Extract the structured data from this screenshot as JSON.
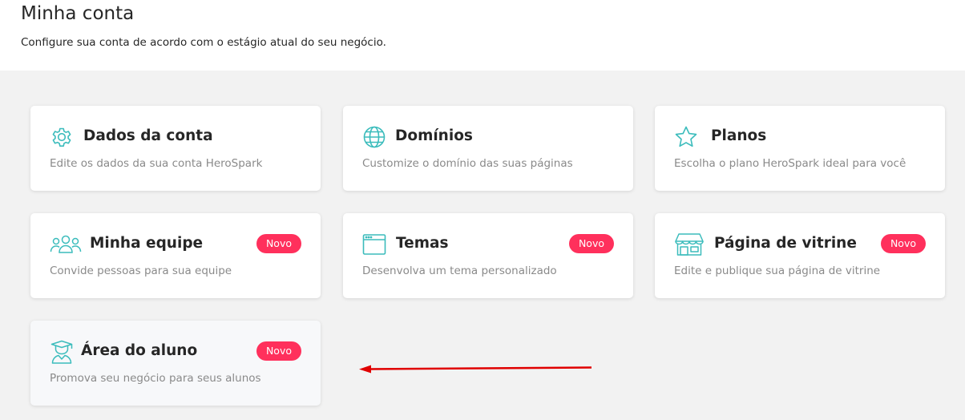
{
  "header": {
    "title": "Minha conta",
    "subtitle": "Configure sua conta de acordo com o estágio atual do seu negócio."
  },
  "colors": {
    "icon": "#3bbcbc",
    "badge": "#ff305c",
    "annotation_arrow": "#e00000"
  },
  "cards": [
    {
      "icon": "gear-icon",
      "title": "Dados da conta",
      "description": "Edite os dados da sua conta HeroSpark"
    },
    {
      "icon": "globe-icon",
      "title": "Domínios",
      "description": "Customize o domínio das suas páginas"
    },
    {
      "icon": "star-icon",
      "title": "Planos",
      "description": "Escolha o plano HeroSpark ideal para você"
    },
    {
      "icon": "team-icon",
      "title": "Minha equipe",
      "description": "Convide pessoas para sua equipe",
      "badge": "Novo"
    },
    {
      "icon": "browser-window-icon",
      "title": "Temas",
      "description": "Desenvolva um tema personalizado",
      "badge": "Novo"
    },
    {
      "icon": "storefront-icon",
      "title": "Página de vitrine",
      "description": "Edite e publique sua página de vitrine",
      "badge": "Novo"
    },
    {
      "icon": "graduate-icon",
      "title": "Área do aluno",
      "description": "Promova seu negócio para seus alunos",
      "badge": "Novo"
    }
  ]
}
